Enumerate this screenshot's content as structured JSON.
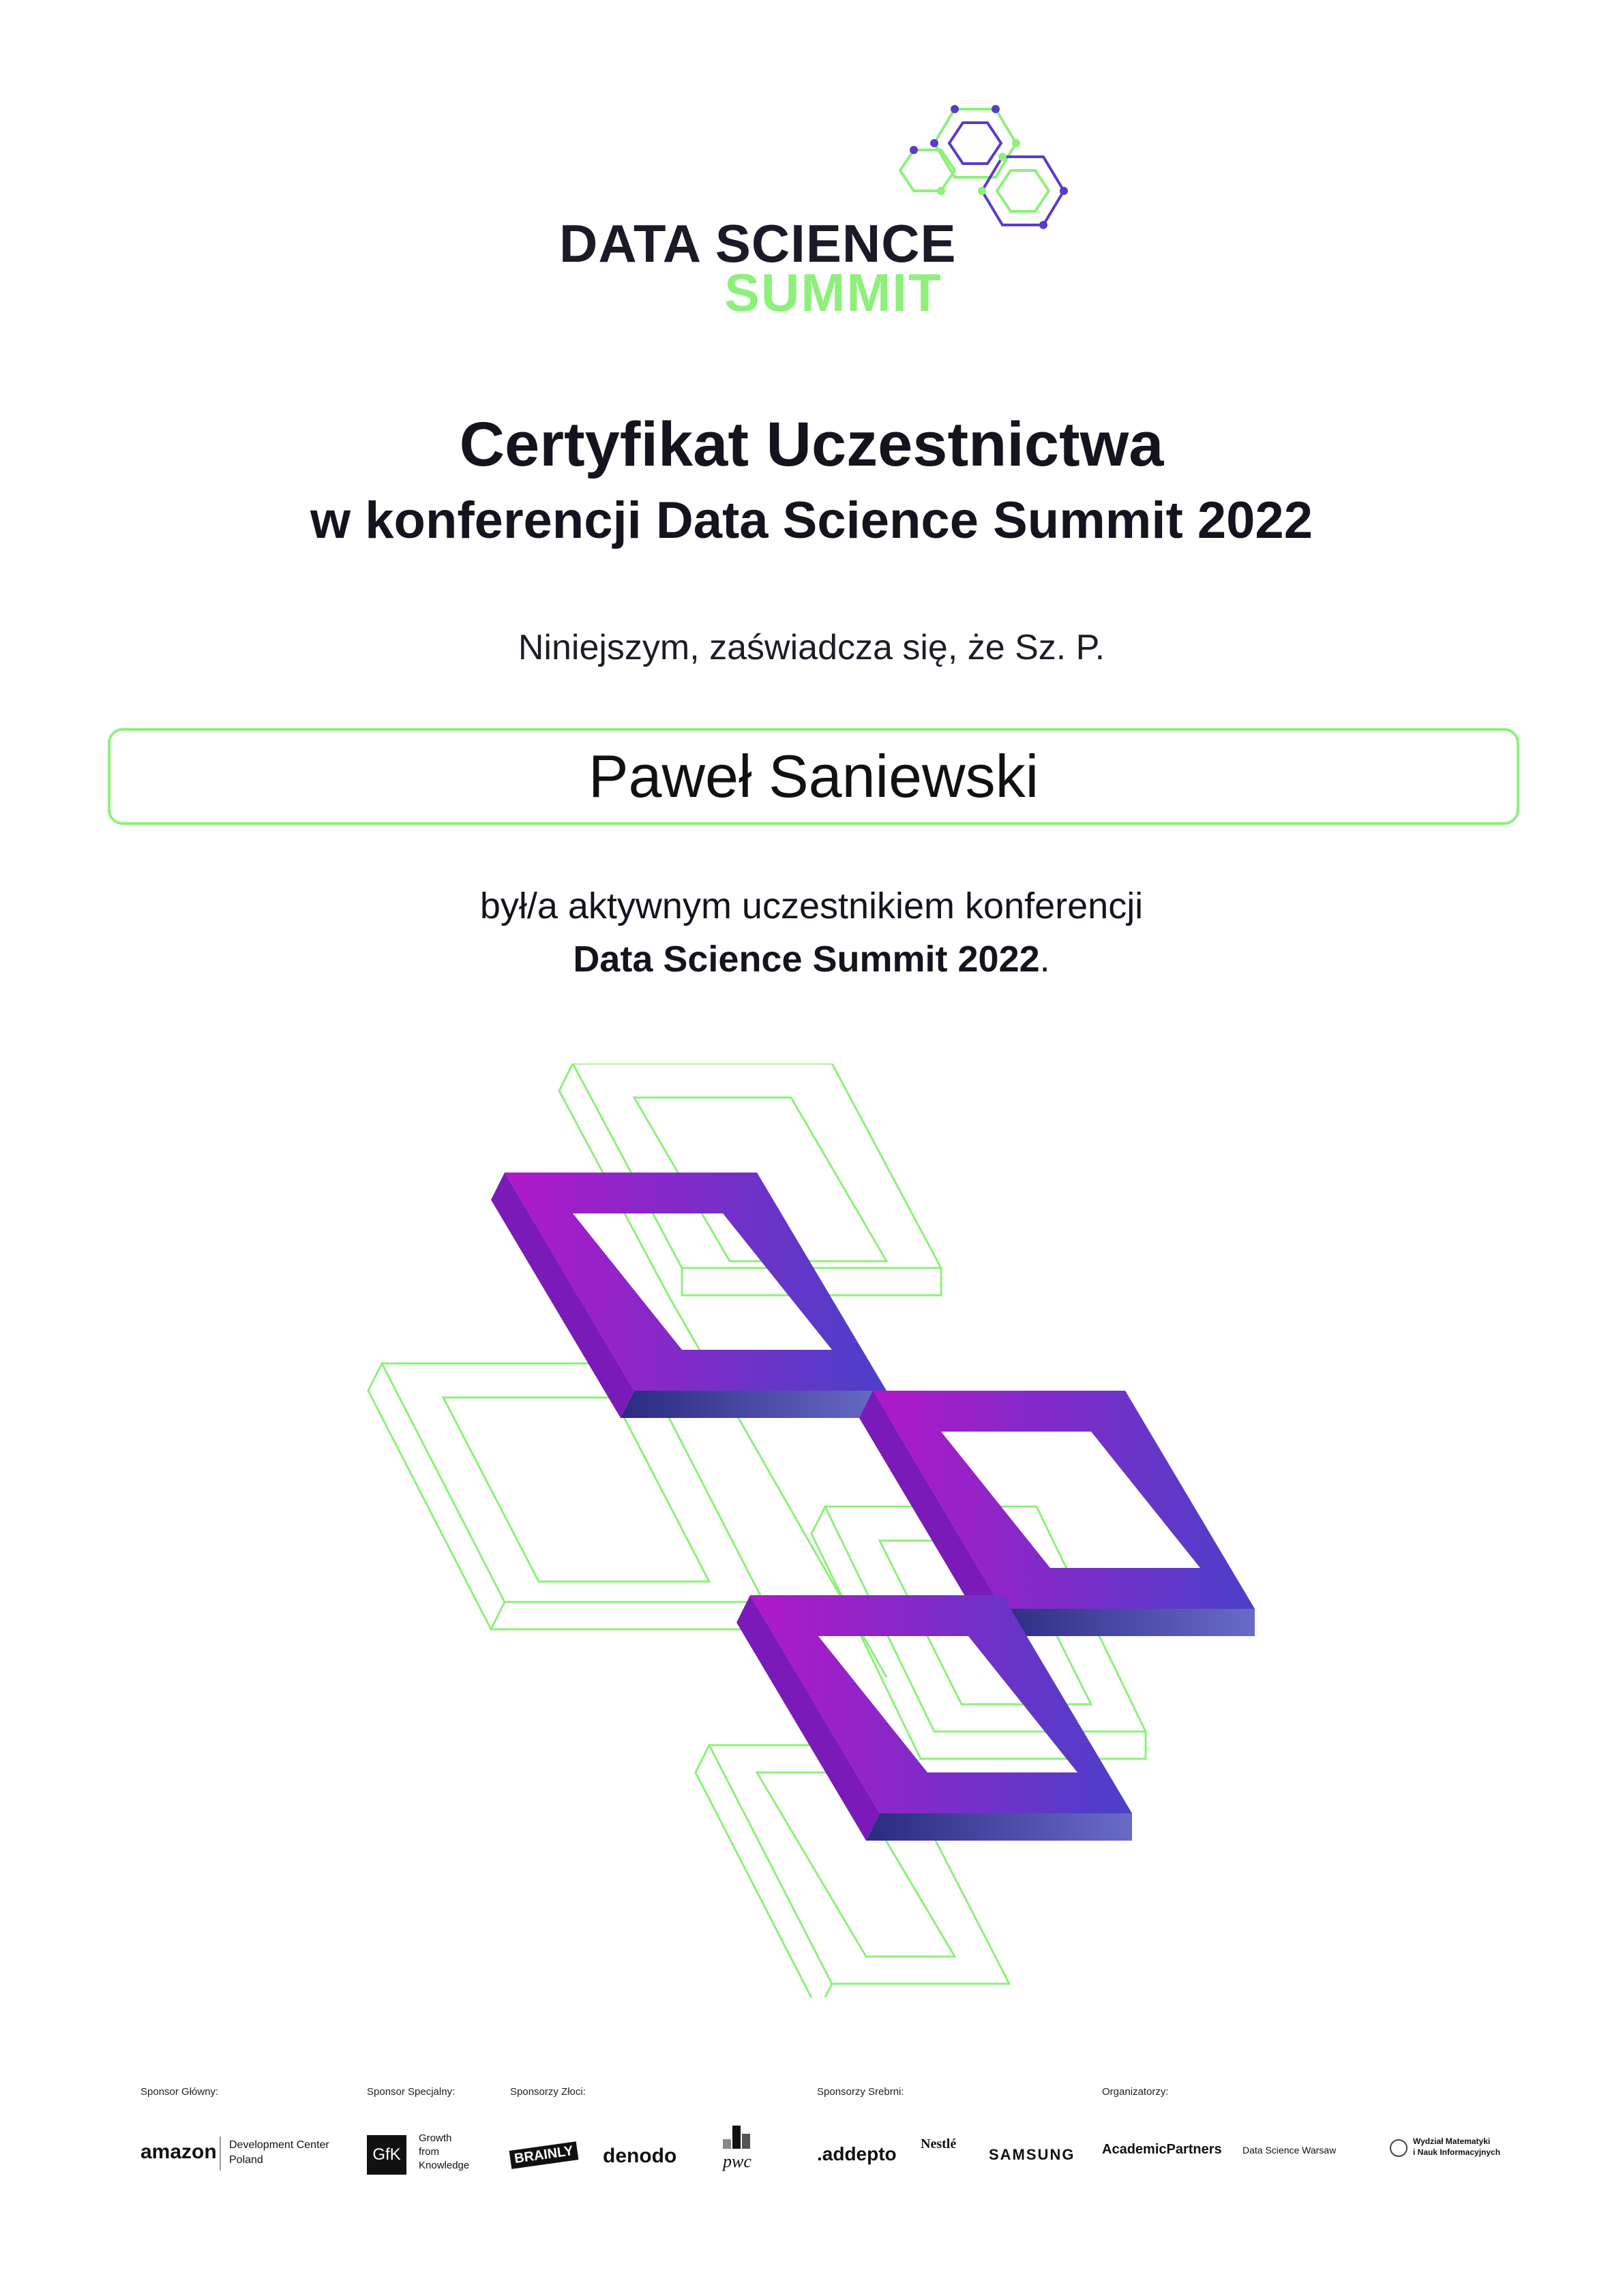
{
  "logo": {
    "line1": "DATA SCIENCE",
    "line2": "SUMMIT"
  },
  "certificate": {
    "title": "Certyfikat Uczestnictwa",
    "subtitle": "w konferencji Data Science Summit 2022",
    "intro": "Niniejszym, zaświadcza się, że Sz. P.",
    "participant_name": "Paweł Saniewski",
    "statement": "był/a aktywnym uczestnikiem konferencji",
    "event_name": "Data Science Summit 2022",
    "event_suffix": "."
  },
  "sponsors": {
    "main_label": "Sponsor Główny:",
    "special_label": "Sponsor Specjalny:",
    "gold_label": "Sponsorzy Złoci:",
    "silver_label": "Sponsorzy Srebrni:",
    "organizers_label": "Organizatorzy:",
    "amazon": "amazon",
    "amazon_sub1": "Development Center",
    "amazon_sub2": "Poland",
    "gfk": "GfK",
    "gfk_sub1": "Growth",
    "gfk_sub2": "from",
    "gfk_sub3": "Knowledge",
    "brainly": "BRAINLY",
    "denodo": "denodo",
    "pwc": "pwc",
    "addepto": ".addepto",
    "nestle": "Nestlé",
    "samsung": "SAMSUNG",
    "academic_partners": "AcademicPartners",
    "data_science_warsaw": "Data Science Warsaw",
    "faculty1": "Wydział Matematyki",
    "faculty2": "i Nauk Informacyjnych"
  },
  "colors": {
    "green": "#8ef07a",
    "purple": "#a218c8",
    "indigo": "#4a40c8",
    "dark": "#14141f"
  }
}
